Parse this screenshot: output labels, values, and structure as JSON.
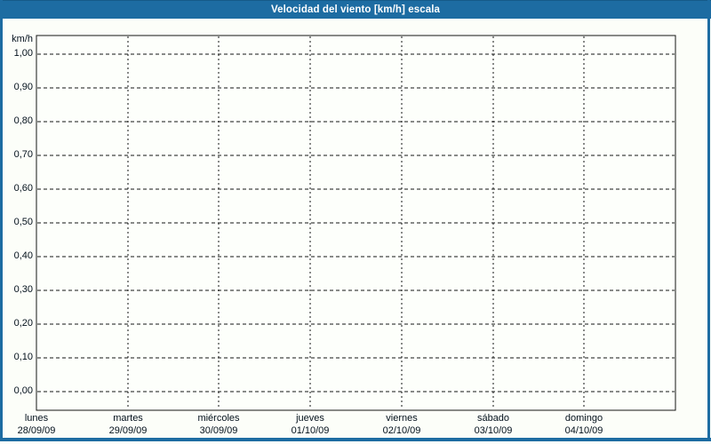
{
  "window": {
    "background": "#fcfef9",
    "frame_color": "#1d6ca2"
  },
  "header": {
    "title": "Velocidad del viento [km/h] escala",
    "text_color": "#ffffff"
  },
  "chart_data": {
    "type": "line",
    "title": "Velocidad del viento [km/h] escala",
    "ylabel": "km/h",
    "ylim": [
      0.0,
      1.0
    ],
    "ytick_step": 0.1,
    "yticks": [
      "1,00",
      "0,90",
      "0,80",
      "0,70",
      "0,60",
      "0,50",
      "0,40",
      "0,30",
      "0,20",
      "0,10",
      "0,00"
    ],
    "x_categories": [
      {
        "day": "lunes",
        "date": "28/09/09"
      },
      {
        "day": "martes",
        "date": "29/09/09"
      },
      {
        "day": "miércoles",
        "date": "30/09/09"
      },
      {
        "day": "jueves",
        "date": "01/10/09"
      },
      {
        "day": "viernes",
        "date": "02/10/09"
      },
      {
        "day": "sábado",
        "date": "03/10/09"
      },
      {
        "day": "domingo",
        "date": "04/10/09"
      }
    ],
    "series": [],
    "grid": {
      "horizontal": "dashed",
      "vertical": "dashed",
      "color": "#141414"
    },
    "legend_position": "none",
    "plot_background": "#fdfffb"
  }
}
